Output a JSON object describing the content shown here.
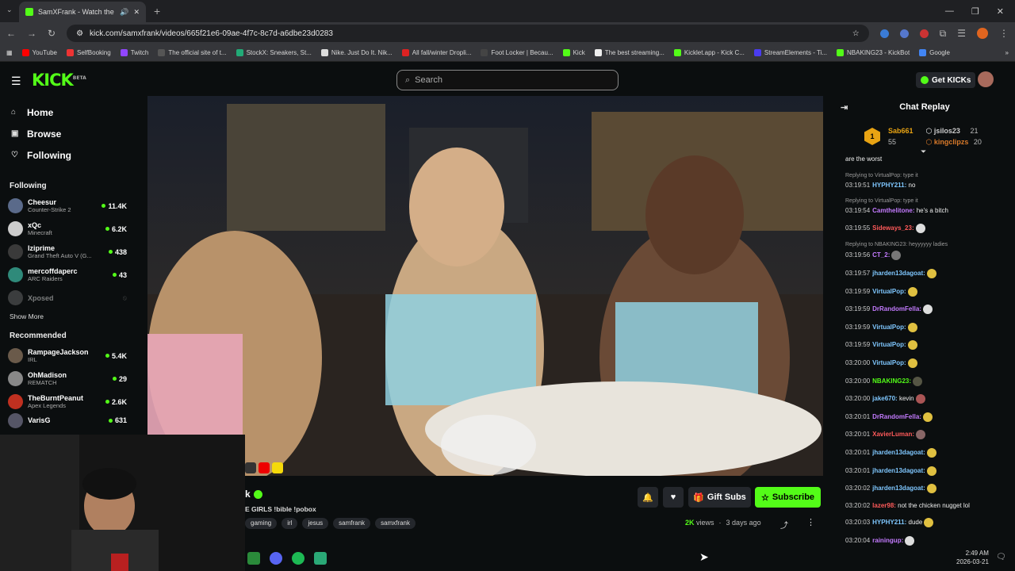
{
  "browser": {
    "tab_title": "SamXFrank - Watch the VO",
    "url": "kick.com/samxfrank/videos/665f21e6-09ae-4f7c-8c7d-a6dbe23d0283",
    "bookmarks": [
      "YouTube",
      "SelfBooking",
      "Twitch",
      "The official site of t...",
      "StockX: Sneakers, St...",
      "Nike. Just Do It. Nik...",
      "All fall/winter Dropli...",
      "Foot Locker | Becau...",
      "Kick",
      "The best streaming...",
      "Kicklet.app - Kick C...",
      "StreamElements - Ti...",
      "NBAKING23 - KickBot",
      "Google"
    ]
  },
  "header": {
    "logo": "KICK",
    "logo_sup": "BETA",
    "search_placeholder": "Search",
    "get_kicks": "Get KICKs"
  },
  "sidebar": {
    "nav": [
      {
        "label": "Home",
        "icon": "home-icon"
      },
      {
        "label": "Browse",
        "icon": "browse-icon"
      },
      {
        "label": "Following",
        "icon": "heart-icon"
      }
    ],
    "following_title": "Following",
    "following": [
      {
        "name": "Cheesur",
        "game": "Counter-Strike 2",
        "viewers": "11.4K"
      },
      {
        "name": "xQc",
        "game": "Minecraft",
        "viewers": "6.2K"
      },
      {
        "name": "Iziprime",
        "game": "Grand Theft Auto V (G...",
        "viewers": "438"
      },
      {
        "name": "mercoffdaperc",
        "game": "ARC Raiders",
        "viewers": "43"
      },
      {
        "name": "Xposed",
        "game": "",
        "viewers": ""
      }
    ],
    "show_more": "Show More",
    "recommended_title": "Recommended",
    "recommended": [
      {
        "name": "RampageJackson",
        "game": "IRL",
        "viewers": "5.4K"
      },
      {
        "name": "OhMadison",
        "game": "REMATCH",
        "viewers": "29"
      },
      {
        "name": "TheBurntPeanut",
        "game": "Apex Legends",
        "viewers": "2.6K"
      },
      {
        "name": "VarisG",
        "game": "",
        "viewers": "631"
      }
    ]
  },
  "video_info": {
    "channel_name": "k",
    "title": "E GIRLS !bible !pobox",
    "tags": [
      "gaming",
      "irl",
      "jesus",
      "samfrank",
      "samxfrank"
    ],
    "views_num": "2K",
    "views_label": "views",
    "dot": "·",
    "posted": "3 days ago",
    "gift_subs": "Gift Subs",
    "subscribe": "Subscribe"
  },
  "chat": {
    "title": "Chat Replay",
    "leaders": {
      "first": {
        "rank": "1",
        "name": "Sab661",
        "count": "55"
      },
      "second": {
        "name": "jsilos23",
        "count": "21"
      },
      "third": {
        "name": "kingclipzs",
        "count": "20"
      }
    },
    "messages": [
      {
        "reply": "",
        "ts": "",
        "user": "",
        "color": "#fff",
        "text": "are the worst",
        "emote": ""
      },
      {
        "reply": "Replying to VirtualPop: type it",
        "ts": "03:19:51",
        "user": "HYPHY211:",
        "color": "#7fc7ff",
        "text": " no",
        "emote": ""
      },
      {
        "reply": "Replying to VirtualPop: type it",
        "ts": "03:19:54",
        "user": "Camthelitone:",
        "color": "#c47bff",
        "text": " he's a bitch",
        "emote": ""
      },
      {
        "reply": "",
        "ts": "03:19:55",
        "user": "Sideways_23:",
        "color": "#ff5a5a",
        "text": "",
        "emote": "#ddd"
      },
      {
        "reply": "Replying to NBAKING23: heyyyyyy ladies",
        "ts": "03:19:56",
        "user": "CT_2:",
        "color": "#c47bff",
        "text": "",
        "emote": "#777"
      },
      {
        "reply": "",
        "ts": "03:19:57",
        "user": "jharden13dagoat:",
        "color": "#7fc7ff",
        "text": "",
        "emote": "#e0c040"
      },
      {
        "reply": "",
        "ts": "03:19:59",
        "user": "VirtualPop:",
        "color": "#7fc7ff",
        "text": "",
        "emote": "#e0c040"
      },
      {
        "reply": "",
        "ts": "03:19:59",
        "user": "DrRandomFella:",
        "color": "#c47bff",
        "text": "",
        "emote": "#ddd"
      },
      {
        "reply": "",
        "ts": "03:19:59",
        "user": "VirtualPop:",
        "color": "#7fc7ff",
        "text": "",
        "emote": "#e0c040"
      },
      {
        "reply": "",
        "ts": "03:19:59",
        "user": "VirtualPop:",
        "color": "#7fc7ff",
        "text": "",
        "emote": "#e0c040"
      },
      {
        "reply": "",
        "ts": "03:20:00",
        "user": "VirtualPop:",
        "color": "#7fc7ff",
        "text": "",
        "emote": "#e0c040"
      },
      {
        "reply": "",
        "ts": "03:20:00",
        "user": "NBAKING23:",
        "color": "#53fc18",
        "text": "",
        "emote": "#554"
      },
      {
        "reply": "",
        "ts": "03:20:00",
        "user": "jake670:",
        "color": "#7fc7ff",
        "text": " kevin",
        "emote": "#a55"
      },
      {
        "reply": "",
        "ts": "03:20:01",
        "user": "DrRandomFella:",
        "color": "#c47bff",
        "text": "",
        "emote": "#e0c040"
      },
      {
        "reply": "",
        "ts": "03:20:01",
        "user": "XavierLuman:",
        "color": "#ff5a5a",
        "text": "",
        "emote": "#866"
      },
      {
        "reply": "",
        "ts": "03:20:01",
        "user": "jharden13dagoat:",
        "color": "#7fc7ff",
        "text": "",
        "emote": "#e0c040"
      },
      {
        "reply": "",
        "ts": "03:20:01",
        "user": "jharden13dagoat:",
        "color": "#7fc7ff",
        "text": "",
        "emote": "#e0c040"
      },
      {
        "reply": "",
        "ts": "03:20:02",
        "user": "jharden13dagoat:",
        "color": "#7fc7ff",
        "text": "",
        "emote": "#e0c040"
      },
      {
        "reply": "",
        "ts": "03:20:02",
        "user": "lazer98:",
        "color": "#ff5a5a",
        "text": " not the chicken nugget lol",
        "emote": ""
      },
      {
        "reply": "",
        "ts": "03:20:03",
        "user": "HYPHY211:",
        "color": "#7fc7ff",
        "text": " dude",
        "emote": "#e0c040"
      },
      {
        "reply": "",
        "ts": "03:20:04",
        "user": "rainingup:",
        "color": "#c47bff",
        "text": "",
        "emote": "#ddd"
      }
    ]
  },
  "taskbar": {
    "time": "2:49 AM",
    "date": "2026-03-21"
  },
  "colors": {
    "accent": "#53fc18",
    "background": "#0b0e0f",
    "surface": "#24272c"
  }
}
